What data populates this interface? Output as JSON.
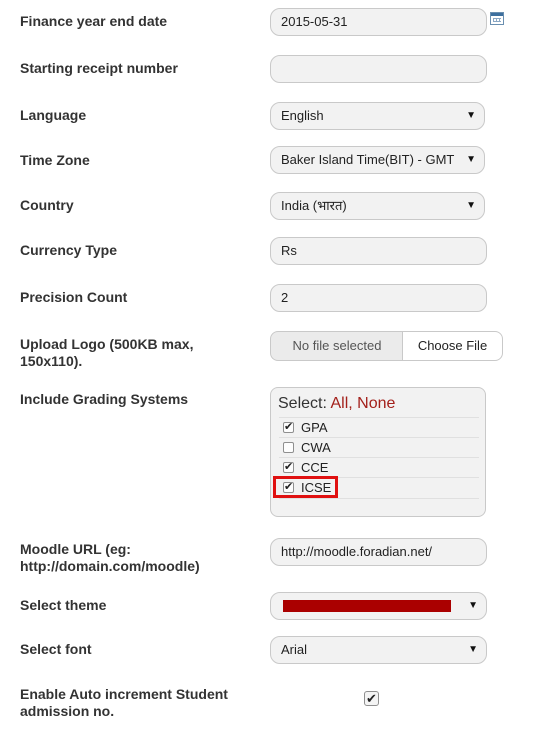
{
  "finance_year_end": {
    "label": "Finance year end date",
    "value": "2015-05-31"
  },
  "starting_receipt": {
    "label": "Starting receipt number",
    "value": ""
  },
  "language": {
    "label": "Language",
    "value": "English"
  },
  "time_zone": {
    "label": "Time Zone",
    "value": "Baker Island Time(BIT) - GMT"
  },
  "country": {
    "label": "Country",
    "value": "India (भारत)"
  },
  "currency_type": {
    "label": "Currency Type",
    "value": "Rs"
  },
  "precision_count": {
    "label": "Precision Count",
    "value": "2"
  },
  "upload_logo": {
    "label": "Upload Logo (500KB max, 150x110).",
    "status": "No file selected",
    "button": "Choose File"
  },
  "grading": {
    "label": "Include Grading Systems",
    "select_prefix": "Select:",
    "all": "All",
    "separator": ",",
    "none": "None",
    "items": [
      {
        "label": "GPA",
        "checked": true
      },
      {
        "label": "CWA",
        "checked": false
      },
      {
        "label": "CCE",
        "checked": true
      },
      {
        "label": "ICSE",
        "checked": true,
        "highlighted": true
      }
    ]
  },
  "moodle_url": {
    "label": "Moodle URL (eg: http://domain.com/moodle)",
    "value": "http://moodle.foradian.net/"
  },
  "select_theme": {
    "label": "Select theme",
    "swatch_color": "#aa0000"
  },
  "select_font": {
    "label": "Select font",
    "value": "Arial"
  },
  "auto_increment": {
    "label": "Enable Auto increment Student admission no.",
    "checked": true
  },
  "icons": {
    "calendar": "calendar-icon",
    "dropdown_arrow": "▼",
    "check": "✔"
  },
  "colors": {
    "link": "#a3201b",
    "highlight": "#e01010"
  }
}
